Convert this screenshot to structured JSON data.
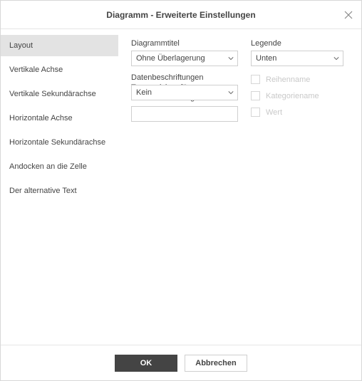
{
  "dialog": {
    "title": "Diagramm - Erweiterte Einstellungen"
  },
  "sidebar": {
    "items": [
      {
        "label": "Layout",
        "active": true
      },
      {
        "label": "Vertikale Achse",
        "active": false
      },
      {
        "label": "Vertikale Sekundärachse",
        "active": false
      },
      {
        "label": "Horizontale Achse",
        "active": false
      },
      {
        "label": "Horizontale Sekundärachse",
        "active": false
      },
      {
        "label": "Andocken an die Zelle",
        "active": false
      },
      {
        "label": "Der alternative Text",
        "active": false
      }
    ]
  },
  "content": {
    "chartTitle": {
      "label": "Diagrammtitel",
      "value": "Ohne Überlagerung"
    },
    "legend": {
      "label": "Legende",
      "value": "Unten"
    },
    "dataLabels": {
      "label": "Datenbeschriftungen",
      "value": "Kein"
    },
    "separator": {
      "label": "Trennzeichen für Datenbeschriftungen",
      "value": ""
    },
    "checks": {
      "seriesName": "Reihenname",
      "categoryName": "Kategoriename",
      "value": "Wert"
    }
  },
  "footer": {
    "ok": "OK",
    "cancel": "Abbrechen"
  }
}
